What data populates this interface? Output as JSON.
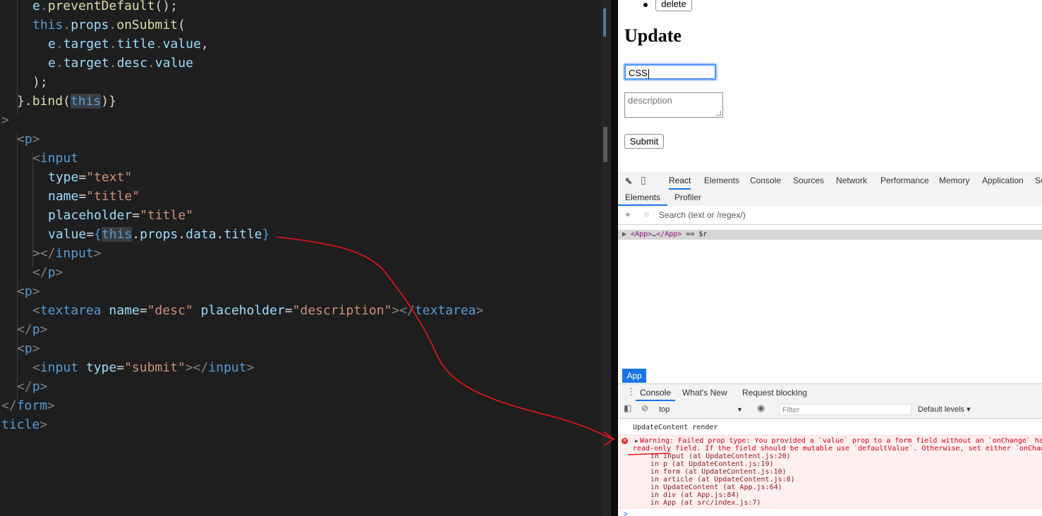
{
  "editor": {
    "lines": [
      [
        [
          "var",
          "e"
        ],
        [
          "pun",
          "."
        ],
        [
          "fn",
          "preventDefault"
        ],
        [
          "txt",
          "();"
        ]
      ],
      [
        [
          "kw",
          "this"
        ],
        [
          "pun",
          "."
        ],
        [
          "var",
          "props"
        ],
        [
          "pun",
          "."
        ],
        [
          "fn",
          "onSubmit"
        ],
        [
          "txt",
          "("
        ]
      ],
      [
        [
          "var",
          "e"
        ],
        [
          "pun",
          "."
        ],
        [
          "var",
          "target"
        ],
        [
          "pun",
          "."
        ],
        [
          "var",
          "title"
        ],
        [
          "pun",
          "."
        ],
        [
          "var",
          "value"
        ],
        [
          "txt",
          ","
        ]
      ],
      [
        [
          "var",
          "e"
        ],
        [
          "pun",
          "."
        ],
        [
          "var",
          "target"
        ],
        [
          "pun",
          "."
        ],
        [
          "var",
          "desc"
        ],
        [
          "pun",
          "."
        ],
        [
          "var",
          "value"
        ]
      ],
      [
        [
          "txt",
          ");"
        ]
      ],
      [
        [
          "txt",
          "}."
        ],
        [
          "fn",
          "bind"
        ],
        [
          "txt",
          "("
        ],
        [
          "kw hl",
          "this"
        ],
        [
          "txt",
          ")}"
        ]
      ],
      [
        [
          "pun",
          ">"
        ]
      ],
      [
        [
          "pun",
          "<"
        ],
        [
          "tag",
          "p"
        ],
        [
          "pun",
          ">"
        ]
      ],
      [
        [
          "pun",
          "<"
        ],
        [
          "tag",
          "input"
        ]
      ],
      [
        [
          "attr",
          "type"
        ],
        [
          "txt",
          "="
        ],
        [
          "str",
          "\"text\""
        ]
      ],
      [
        [
          "attr",
          "name"
        ],
        [
          "txt",
          "="
        ],
        [
          "str",
          "\"title\""
        ]
      ],
      [
        [
          "attr",
          "placeholder"
        ],
        [
          "txt",
          "="
        ],
        [
          "str",
          "\"title\""
        ]
      ],
      [
        [
          "attr",
          "value"
        ],
        [
          "txt",
          "="
        ],
        [
          "kw",
          "{"
        ],
        [
          "kw hl",
          "this"
        ],
        [
          "txt",
          "."
        ],
        [
          "var",
          "props"
        ],
        [
          "txt",
          "."
        ],
        [
          "var",
          "data"
        ],
        [
          "txt",
          "."
        ],
        [
          "var",
          "title"
        ],
        [
          "kw",
          "}"
        ]
      ],
      [
        [
          "pun",
          "></"
        ],
        [
          "tag",
          "input"
        ],
        [
          "pun",
          ">"
        ]
      ],
      [
        [
          "pun",
          "</"
        ],
        [
          "tag",
          "p"
        ],
        [
          "pun",
          ">"
        ]
      ],
      [
        [
          "pun",
          "<"
        ],
        [
          "tag",
          "p"
        ],
        [
          "pun",
          ">"
        ]
      ],
      [
        [
          "pun",
          "<"
        ],
        [
          "tag",
          "textarea"
        ],
        [
          "txt",
          " "
        ],
        [
          "attr",
          "name"
        ],
        [
          "txt",
          "="
        ],
        [
          "str",
          "\"desc\""
        ],
        [
          "txt",
          " "
        ],
        [
          "attr",
          "placeholder"
        ],
        [
          "txt",
          "="
        ],
        [
          "str",
          "\"description\""
        ],
        [
          "pun",
          "></"
        ],
        [
          "tag",
          "textarea"
        ],
        [
          "pun",
          ">"
        ]
      ],
      [
        [
          "pun",
          "</"
        ],
        [
          "tag",
          "p"
        ],
        [
          "pun",
          ">"
        ]
      ],
      [
        [
          "pun",
          "<"
        ],
        [
          "tag",
          "p"
        ],
        [
          "pun",
          ">"
        ]
      ],
      [
        [
          "pun",
          "<"
        ],
        [
          "tag",
          "input"
        ],
        [
          "txt",
          " "
        ],
        [
          "attr",
          "type"
        ],
        [
          "txt",
          "="
        ],
        [
          "str",
          "\"submit\""
        ],
        [
          "pun",
          "></"
        ],
        [
          "tag",
          "input"
        ],
        [
          "pun",
          ">"
        ]
      ],
      [
        [
          "pun",
          "</"
        ],
        [
          "tag",
          "p"
        ],
        [
          "pun",
          ">"
        ]
      ],
      [
        [
          "pun",
          "</"
        ],
        [
          "tag",
          "form"
        ],
        [
          "pun",
          ">"
        ]
      ],
      [
        [
          "tag",
          "ticle"
        ],
        [
          "pun",
          ">"
        ]
      ]
    ]
  },
  "page": {
    "delete_label": "delete",
    "heading": "Update",
    "title_value": "CSS",
    "desc_placeholder": "description",
    "submit_label": "Submit"
  },
  "devtools": {
    "main_tabs": [
      "React",
      "Elements",
      "Console",
      "Sources",
      "Network",
      "Performance",
      "Memory",
      "Application",
      "Se"
    ],
    "react_subtabs": [
      "Elements",
      "Profiler"
    ],
    "search_placeholder": "Search (text or /regex/)",
    "tree_row": {
      "arrow": "▶",
      "open_tag": "<App>",
      "ellipsis": "…",
      "close_tag": "</App>",
      "suffix": " == $r"
    },
    "app_pill": "App",
    "drawer_tabs": [
      "Console",
      "What's New",
      "Request blocking"
    ],
    "context": "top",
    "filter_placeholder": "Filter",
    "levels": "Default levels ▾",
    "log_info": "UpdateContent render",
    "warning": {
      "line1": "Warning: Failed prop type: You provided a `value` prop to a form field without an `onChange` han",
      "line2": "read-only field. If the field should be mutable use `defaultValue`. Otherwise, set either `onChang",
      "trace": [
        "in input (at UpdateContent.js:20)",
        "in p (at UpdateContent.js:19)",
        "in form (at UpdateContent.js:10)",
        "in article (at UpdateContent.js:8)",
        "in UpdateContent (at App.js:64)",
        "in div (at App.js:84)",
        "in App (at src/index.js:7)"
      ]
    },
    "prompt": ">"
  },
  "colors": {
    "editor_bg": "#1e1e1e",
    "accent": "#1a73e8",
    "annotation": "#e8141b",
    "error": "#d1001a"
  }
}
